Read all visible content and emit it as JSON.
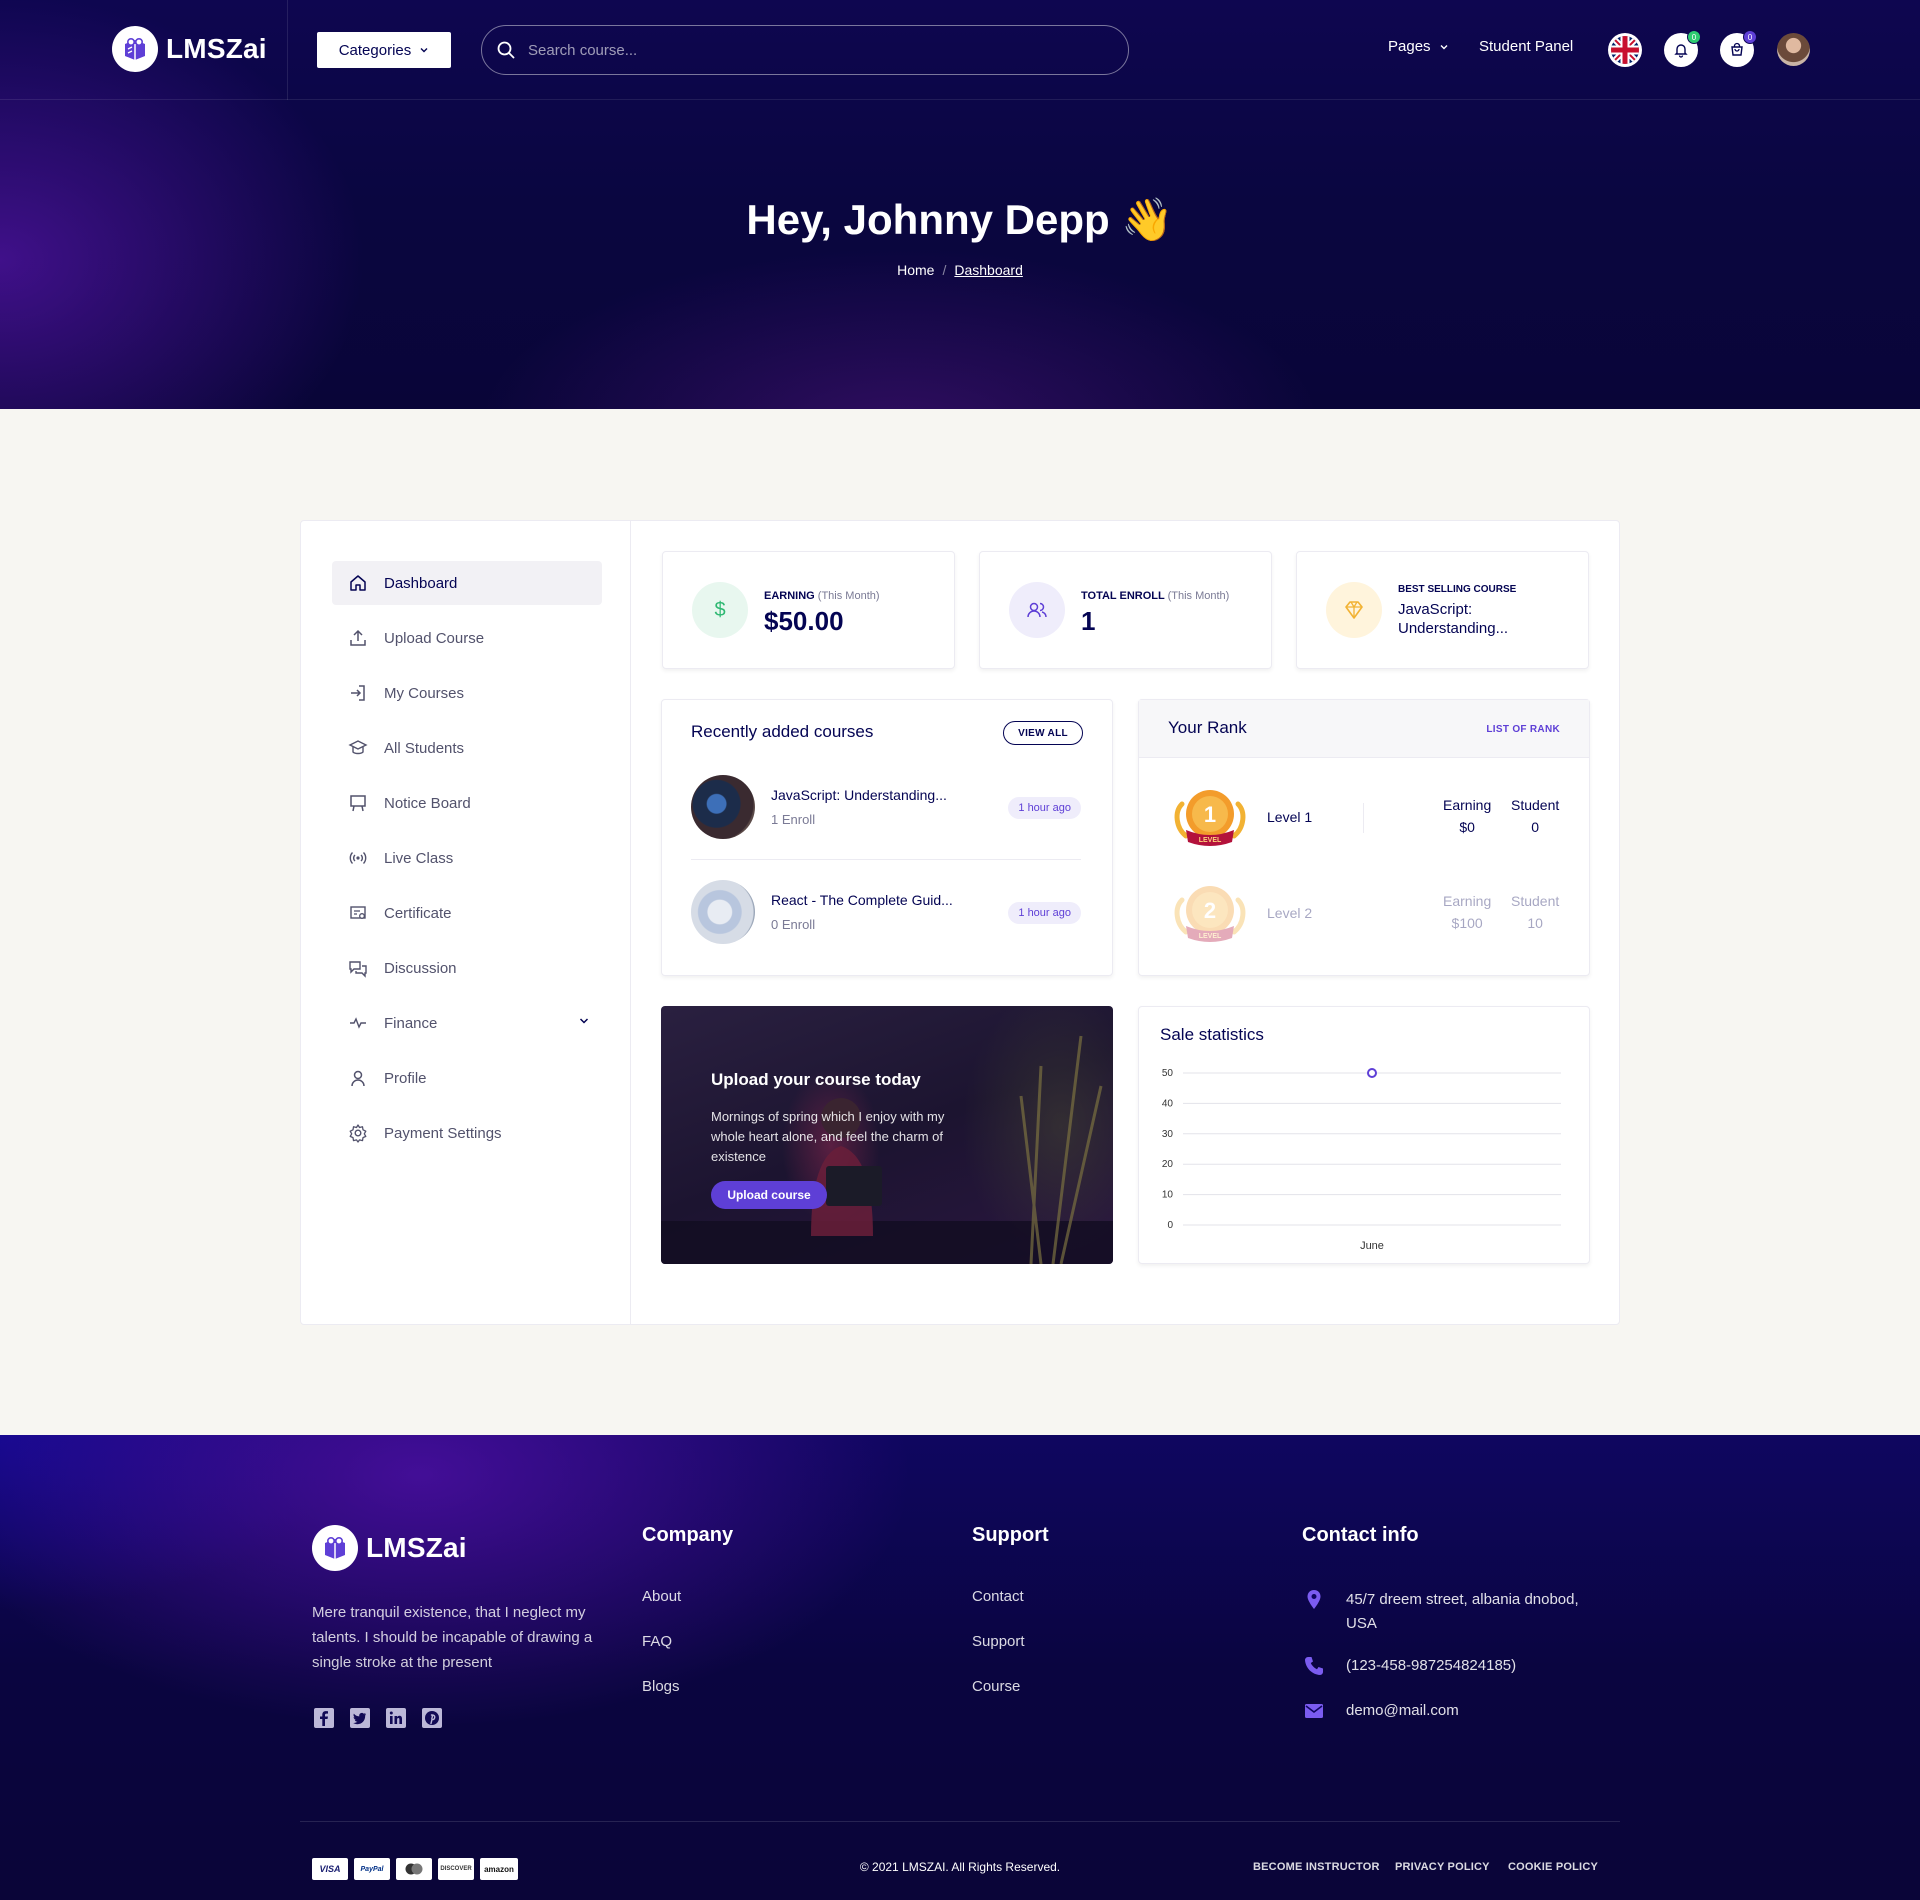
{
  "header": {
    "brand": "LMSZai",
    "categories_label": "Categories",
    "search_placeholder": "Search course...",
    "nav_pages": "Pages",
    "nav_student_panel": "Student Panel",
    "notification_count": "0",
    "cart_count": "0",
    "colors": {
      "accent": "#5e3fd6",
      "notification_badge": "#2ecc71",
      "cart_badge": "#5e3fd6"
    }
  },
  "hero": {
    "greeting": "Hey, Johnny Depp 👋",
    "breadcrumb": {
      "home": "Home",
      "current": "Dashboard"
    }
  },
  "sidebar": {
    "items": [
      {
        "label": "Dashboard",
        "icon": "home-icon",
        "active": true
      },
      {
        "label": "Upload Course",
        "icon": "upload-icon"
      },
      {
        "label": "My Courses",
        "icon": "login-icon"
      },
      {
        "label": "All Students",
        "icon": "graduation-cap-icon"
      },
      {
        "label": "Notice Board",
        "icon": "board-icon"
      },
      {
        "label": "Live Class",
        "icon": "broadcast-icon"
      },
      {
        "label": "Certificate",
        "icon": "certificate-icon"
      },
      {
        "label": "Discussion",
        "icon": "chat-icon"
      },
      {
        "label": "Finance",
        "icon": "pulse-icon",
        "has_dropdown": true
      },
      {
        "label": "Profile",
        "icon": "user-icon"
      },
      {
        "label": "Payment Settings",
        "icon": "gear-icon"
      }
    ]
  },
  "stats": {
    "earning": {
      "label": "EARNING",
      "sub": "(This Month)",
      "value": "$50.00",
      "icon": "dollar-icon"
    },
    "enroll": {
      "label": "TOTAL ENROLL",
      "sub": "(This Month)",
      "value": "1",
      "icon": "users-icon"
    },
    "best": {
      "label": "BEST SELLING COURSE",
      "value": "JavaScript: Understanding...",
      "icon": "diamond-icon"
    }
  },
  "recent": {
    "title": "Recently added courses",
    "view_all": "VIEW ALL",
    "courses": [
      {
        "name": "JavaScript: Understanding...",
        "enroll": "1 Enroll",
        "time": "1 hour ago"
      },
      {
        "name": "React - The Complete Guid...",
        "enroll": "0 Enroll",
        "time": "1 hour ago"
      }
    ]
  },
  "rank": {
    "title": "Your Rank",
    "link": "LIST OF RANK",
    "earning_label": "Earning",
    "student_label": "Student",
    "medal_text": "LEVEL",
    "levels": [
      {
        "num": "1",
        "name": "Level 1",
        "earning": "$0",
        "student": "0",
        "reached": true
      },
      {
        "num": "2",
        "name": "Level 2",
        "earning": "$100",
        "student": "10",
        "reached": false
      }
    ]
  },
  "promo": {
    "title": "Upload your course today",
    "text": "Mornings of spring which I enjoy with my whole heart alone, and feel the charm of existence",
    "button": "Upload course"
  },
  "chart_data": {
    "type": "line",
    "title": "Sale statistics",
    "categories": [
      "June"
    ],
    "series": [
      {
        "values": [
          50
        ]
      }
    ],
    "ylim": [
      0,
      50
    ],
    "yticks": [
      0,
      10,
      20,
      30,
      40,
      50
    ],
    "grid": true,
    "xlabel": "",
    "ylabel": ""
  },
  "footer": {
    "brand": "LMSZai",
    "about": "Mere tranquil existence, that I neglect my talents. I should be incapable of drawing a single stroke at the present",
    "company": {
      "title": "Company",
      "links": [
        "About",
        "FAQ",
        "Blogs"
      ]
    },
    "support": {
      "title": "Support",
      "links": [
        "Contact",
        "Support",
        "Course"
      ]
    },
    "contact": {
      "title": "Contact info",
      "address": "45/7 dreem street, albania dnobod, USA",
      "phone": "(123-458-987254824185)",
      "email": "demo@mail.com"
    },
    "payments": [
      "VISA",
      "PayPal",
      "MC",
      "DISCOVER",
      "amazon"
    ],
    "copyright": "© 2021 LMSZAI. All Rights Reserved.",
    "bottom_links": [
      "BECOME INSTRUCTOR",
      "PRIVACY POLICY",
      "COOKIE POLICY"
    ]
  }
}
